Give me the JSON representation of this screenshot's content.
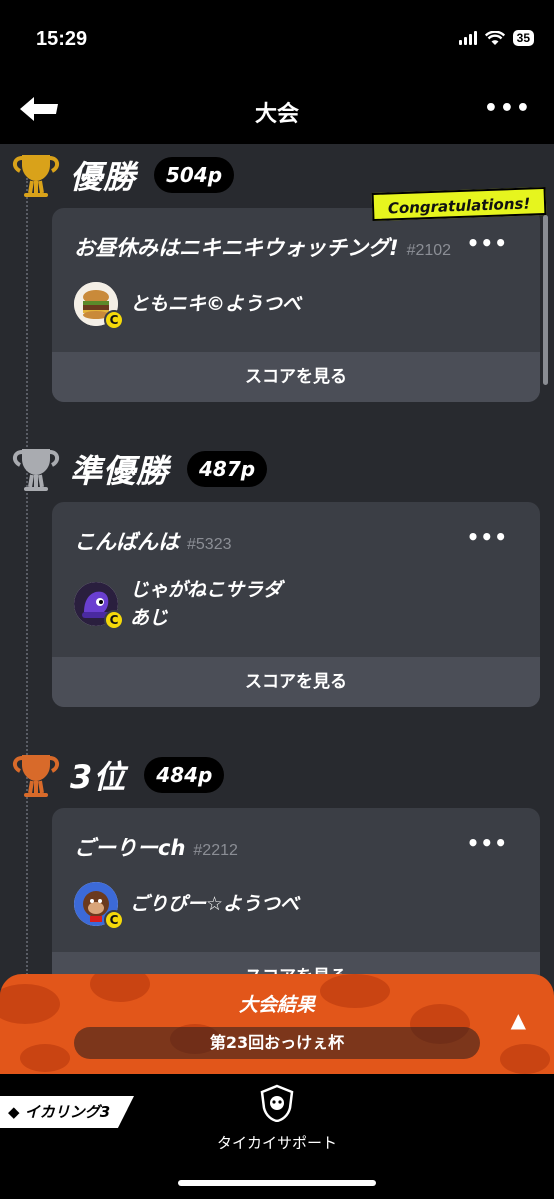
{
  "status": {
    "time": "15:29",
    "battery": "35"
  },
  "nav": {
    "title": "大会",
    "more": "•••"
  },
  "ranks": [
    {
      "title": "優勝",
      "points": "504p",
      "trophy_color": "#d9a21a",
      "team_name": "お昼休みはニキニキウォッチング!",
      "team_id": "#2102",
      "player_name": "ともニキ©ようつべ",
      "badge": "C",
      "score_button": "スコアを見る",
      "more": "•••"
    },
    {
      "title": "準優勝",
      "points": "487p",
      "trophy_color": "#a9abb0",
      "team_name": "こんばんは",
      "team_id": "#5323",
      "player_name": "じゃがねこサラダあじ",
      "badge": "C",
      "score_button": "スコアを見る",
      "more": "•••"
    },
    {
      "title": "3位",
      "points": "484p",
      "trophy_color": "#d86a2a",
      "team_name": "ごーりーch",
      "team_id": "#2212",
      "player_name": "ごりぴー☆ようつべ",
      "badge": "C",
      "score_button": "スコアを見る",
      "more": "•••"
    }
  ],
  "congrats_label": "Congratulations!",
  "result_panel": {
    "title": "大会結果",
    "subtitle": "第23回おっけぇ杯",
    "arrow": "▲"
  },
  "bottom_bar": {
    "logo": "◆ イカリング3",
    "support_label": "タイカイサポート"
  },
  "colors": {
    "accent_orange": "#e2561a",
    "congrats_yellow": "#e6f51e",
    "badge_yellow": "#f5d90a"
  }
}
